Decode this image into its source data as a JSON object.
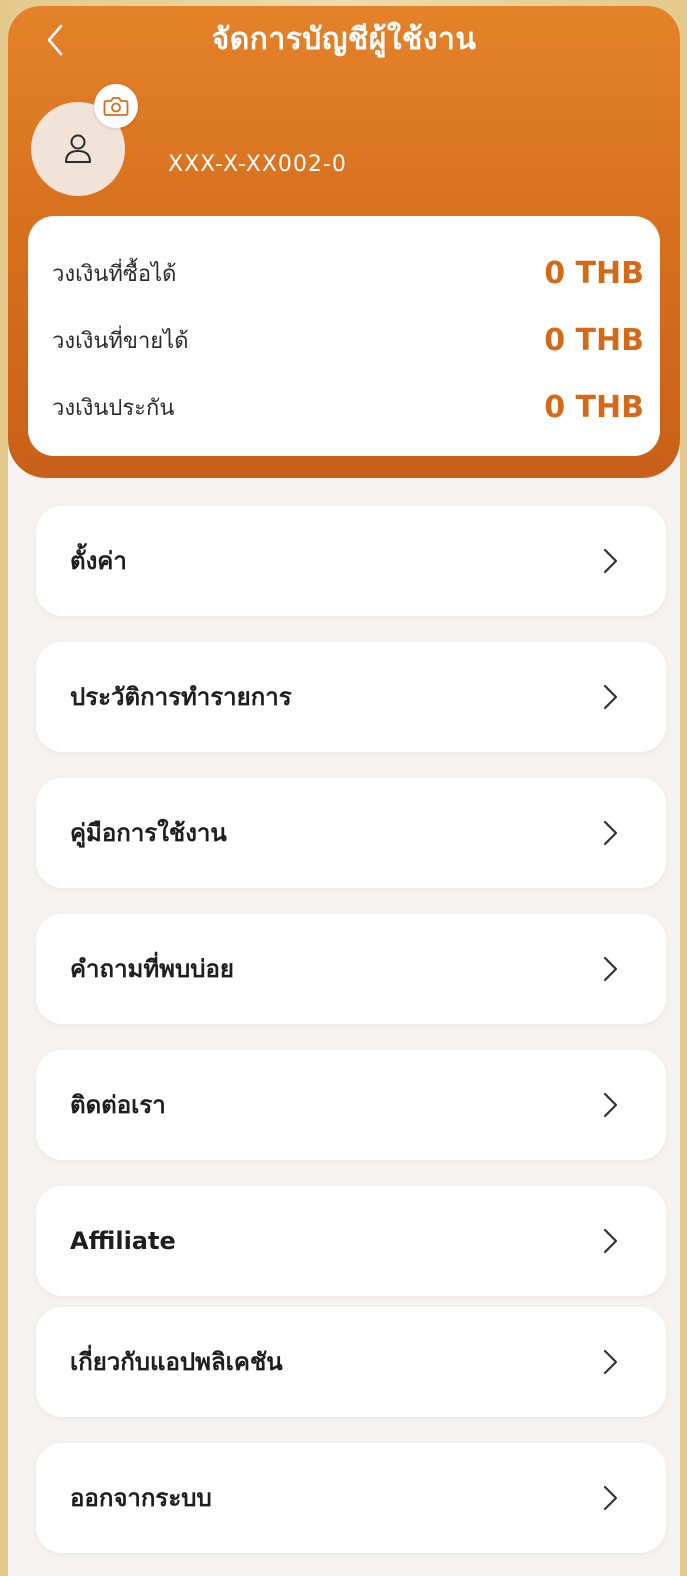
{
  "header": {
    "title": "จัดการบัญชีผู้ใช้งาน",
    "account_number": "XXX-X-XX002-0",
    "icons": {
      "back": "chevron-left-icon",
      "avatar": "user-icon",
      "camera": "camera-icon"
    }
  },
  "balances": [
    {
      "label": "วงเงินที่ซื้อได้",
      "value": "0 THB"
    },
    {
      "label": "วงเงินที่ขายได้",
      "value": "0 THB"
    },
    {
      "label": "วงเงินประกัน",
      "value": "0 THB"
    }
  ],
  "menu": [
    {
      "label": "ตั้งค่า"
    },
    {
      "label": "ประวัติการทำรายการ"
    },
    {
      "label": "คู่มือการใช้งาน"
    },
    {
      "label": "คำถามที่พบบ่อย"
    },
    {
      "label": "ติดต่อเรา"
    },
    {
      "label": "Affiliate"
    },
    {
      "label": "เกี่ยวกับแอปพลิเคชัน"
    },
    {
      "label": "ออกจากระบบ"
    }
  ],
  "colors": {
    "accent": "#d56d1b",
    "value_text": "#d46a17",
    "background": "#f4f3f2"
  }
}
